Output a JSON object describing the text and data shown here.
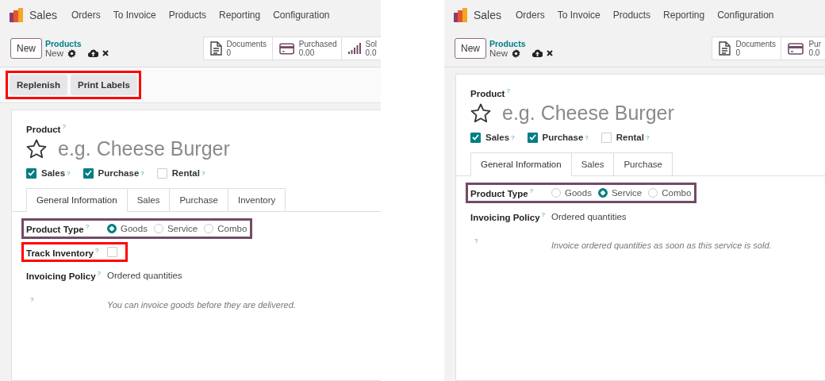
{
  "panels": [
    {
      "app_name": "Sales",
      "menu": [
        "Orders",
        "To Invoice",
        "Products",
        "Reporting",
        "Configuration"
      ],
      "new_button": "New",
      "breadcrumb": {
        "parent": "Products",
        "current": "New"
      },
      "stats": [
        {
          "kind": "document",
          "label": "Documents",
          "value": "0"
        },
        {
          "kind": "card",
          "label": "Purchased",
          "value": "0.00"
        },
        {
          "kind": "chart",
          "label": "Sol",
          "value": "0.0"
        }
      ],
      "actions": {
        "color": "#ff0000",
        "buttons": [
          "Replenish",
          "Print Labels"
        ]
      },
      "form": {
        "product_label": "Product",
        "product_mark": "?",
        "name_placeholder": "e.g. Cheese Burger",
        "starred": false,
        "options": [
          {
            "label": "Sales",
            "mark": "?",
            "checked": true
          },
          {
            "label": "Purchase",
            "mark": "?",
            "checked": true
          },
          {
            "label": "Rental",
            "mark": "?",
            "checked": false
          }
        ],
        "tabs": [
          {
            "label": "General Information",
            "selected": true
          },
          {
            "label": "Sales",
            "selected": false
          },
          {
            "label": "Purchase",
            "selected": false
          },
          {
            "label": "Inventory",
            "selected": false
          }
        ],
        "fields": [
          {
            "kind": "radio",
            "label": "Product Type",
            "mark": "?",
            "color": "#714b67",
            "choices": [
              {
                "label": "Goods",
                "selected": true
              },
              {
                "label": "Service",
                "selected": false
              },
              {
                "label": "Combo",
                "selected": false
              }
            ]
          },
          {
            "kind": "checkbox",
            "label": "Track Inventory",
            "mark": "?",
            "color": "#ff0000",
            "checked": false
          },
          {
            "kind": "text",
            "label": "Invoicing Policy",
            "mark": "?",
            "value": "Ordered quantities"
          },
          {
            "kind": "note",
            "mark": "?",
            "value": "You can invoice goods before they are delivered."
          }
        ]
      }
    },
    {
      "app_name": "Sales",
      "menu": [
        "Orders",
        "To Invoice",
        "Products",
        "Reporting",
        "Configuration"
      ],
      "new_button": "New",
      "breadcrumb": {
        "parent": "Products",
        "current": "New"
      },
      "stats": [
        {
          "kind": "document",
          "label": "Documents",
          "value": "0"
        },
        {
          "kind": "card",
          "label": "Pur",
          "value": "0.0"
        }
      ],
      "form": {
        "product_label": "Product",
        "product_mark": "?",
        "name_placeholder": "e.g. Cheese Burger",
        "starred": false,
        "options": [
          {
            "label": "Sales",
            "mark": "?",
            "checked": true
          },
          {
            "label": "Purchase",
            "mark": "?",
            "checked": true
          },
          {
            "label": "Rental",
            "mark": "?",
            "checked": false
          }
        ],
        "tabs": [
          {
            "label": "General Information",
            "selected": true
          },
          {
            "label": "Sales",
            "selected": false
          },
          {
            "label": "Purchase",
            "selected": false
          }
        ],
        "fields": [
          {
            "kind": "radio",
            "label": "Product Type",
            "mark": "?",
            "color": "#714b67",
            "choices": [
              {
                "label": "Goods",
                "selected": false
              },
              {
                "label": "Service",
                "selected": true
              },
              {
                "label": "Combo",
                "selected": false
              }
            ]
          },
          {
            "kind": "text",
            "label": "Invoicing Policy",
            "mark": "?",
            "value": "Ordered quantities"
          },
          {
            "kind": "note",
            "mark": "?",
            "value": "Invoice ordered quantities as soon as this service is sold."
          }
        ]
      }
    }
  ]
}
